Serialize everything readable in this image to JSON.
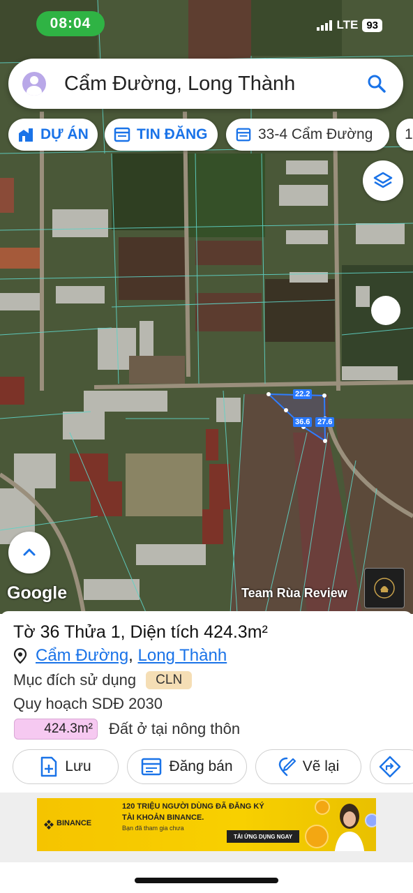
{
  "status": {
    "time": "08:04",
    "network": "LTE",
    "battery": "93"
  },
  "search": {
    "text": "Cẩm Đường, Long Thành"
  },
  "chips": [
    {
      "label": "DỰ ÁN"
    },
    {
      "label": "TIN ĐĂNG"
    },
    {
      "label": "33-4 Cẩm Đường"
    },
    {
      "label": "1"
    }
  ],
  "map": {
    "google_label": "Google",
    "watermark": "Team Rùa Review",
    "parcel_edges": [
      "22.2",
      "36.6",
      "27.6"
    ]
  },
  "parcel": {
    "title_prefix": "Tờ",
    "sheet_no": "36",
    "plot_prefix": "Thửa",
    "plot_no": "1",
    "area_prefix": ", Diện tích",
    "area": "424.3m²",
    "location_1": "Cẩm Đường",
    "location_sep": ",",
    "location_2": "Long Thành",
    "purpose_label": "Mục đích sử dụng",
    "purpose_code": "CLN",
    "plan_label": "Quy hoạch SDĐ 2030",
    "plan_area": "424.3m²",
    "plan_desc": "Đất ở tại nông thôn"
  },
  "actions": {
    "save": "Lưu",
    "sell": "Đăng bán",
    "redraw": "Vẽ lại"
  },
  "ad": {
    "brand": "BINANCE",
    "line1": "120 TRIỆU NGƯỜI DÙNG ĐÃ ĐĂNG KÝ",
    "line2": "TÀI KHOẢN BINANCE.",
    "line3": "Bạn đã tham gia chưa",
    "cta": "TẢI ỨNG DỤNG NGAY"
  },
  "colors": {
    "accent": "#1a73e8",
    "badge": "#f5deb5",
    "area_chip": "#f6c9f1",
    "ad_bg": "#f5c400"
  }
}
